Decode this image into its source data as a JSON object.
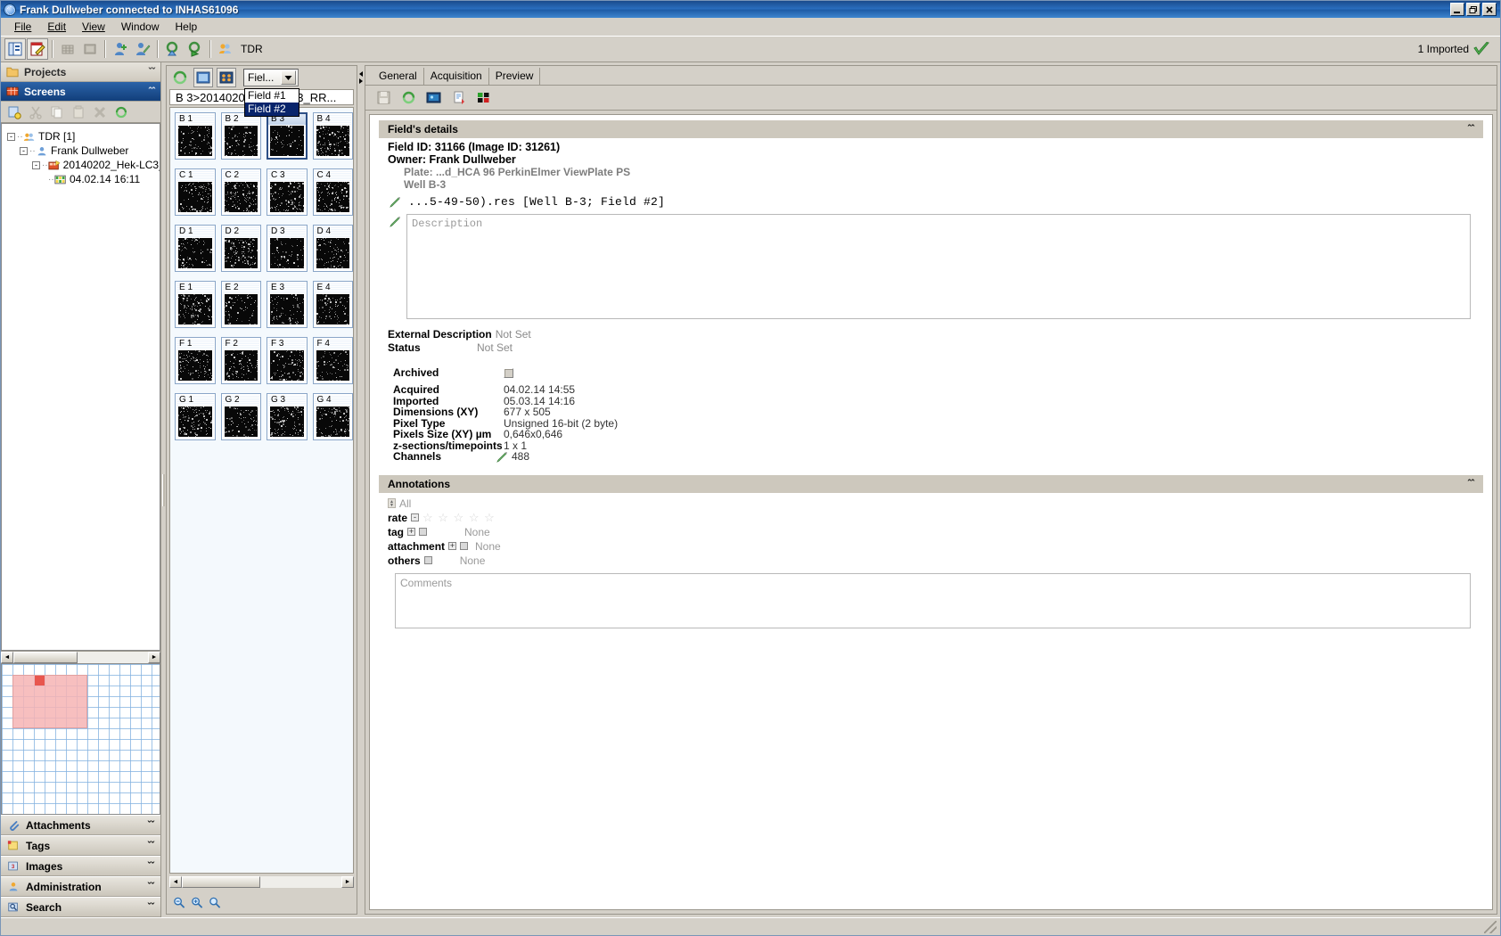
{
  "window": {
    "title": "Frank Dullweber connected to INHAS61096",
    "icon": "app-icon",
    "buttons": {
      "minimize": "_",
      "restore": "❐",
      "close": "✕"
    }
  },
  "menu": {
    "items": [
      "File",
      "Edit",
      "View",
      "Window",
      "Help"
    ]
  },
  "toolbar": {
    "tdr_label": "TDR",
    "status_text": "1 Imported",
    "buttons": [
      "panel-toggle-icon",
      "edit-document-icon",
      "grid-view-icon",
      "image-view-icon",
      "user-add-icon",
      "user-edit-icon",
      "import-icon",
      "export-run-icon",
      "users-group-icon"
    ]
  },
  "sidebar": {
    "groups": [
      {
        "label": "Projects",
        "icon": "folder-icon",
        "state": "collapsed",
        "chevron": "ˇˇ"
      },
      {
        "label": "Screens",
        "icon": "screens-icon",
        "state": "expanded",
        "chevron": "ˆˆ"
      }
    ],
    "tree_toolbar": [
      "new-icon",
      "cut-icon",
      "copy-icon",
      "paste-icon",
      "delete-icon",
      "refresh-icon"
    ],
    "tree": [
      {
        "label": "TDR [1]",
        "icon": "users-group-icon",
        "indent": 0,
        "expander": "-"
      },
      {
        "label": "Frank Dullweber",
        "icon": "user-icon",
        "indent": 1,
        "expander": "-"
      },
      {
        "label": "20140202_Hek-LC3_",
        "icon": "screen-icon",
        "indent": 2,
        "expander": "-"
      },
      {
        "label": "04.02.14 16:11",
        "icon": "plate-icon",
        "indent": 3,
        "expander": ""
      }
    ],
    "bottom_sections": [
      {
        "label": "Attachments",
        "icon": "paperclip-icon",
        "chevron": "ˇˇ"
      },
      {
        "label": "Tags",
        "icon": "tag-note-icon",
        "chevron": "ˇˇ"
      },
      {
        "label": "Images",
        "icon": "images-icon",
        "chevron": "ˇˇ"
      },
      {
        "label": "Administration",
        "icon": "admin-user-icon",
        "chevron": "ˇˇ"
      },
      {
        "label": "Search",
        "icon": "search-icon",
        "chevron": "ˇˇ"
      }
    ]
  },
  "thumbnails": {
    "toolbar": [
      "refresh-icon",
      "single-view-icon",
      "multi-view-icon"
    ],
    "field_selector": {
      "value": "Fiel...",
      "arrow": "▼",
      "open": true,
      "options": [
        "Field #1",
        "Field #2"
      ],
      "selected": "Field #2"
    },
    "title": "B 3>20140202_Hek-LC3_RR...",
    "selected_well": "B 3",
    "rows": [
      {
        "row": "B",
        "wells": [
          "B 1",
          "B 2",
          "B 3",
          "B 4"
        ]
      },
      {
        "row": "C",
        "wells": [
          "C 1",
          "C 2",
          "C 3",
          "C 4"
        ]
      },
      {
        "row": "D",
        "wells": [
          "D 1",
          "D 2",
          "D 3",
          "D 4"
        ]
      },
      {
        "row": "E",
        "wells": [
          "E 1",
          "E 2",
          "E 3",
          "E 4"
        ]
      },
      {
        "row": "F",
        "wells": [
          "F 1",
          "F 2",
          "F 3",
          "F 4"
        ]
      },
      {
        "row": "G",
        "wells": [
          "G 1",
          "G 2",
          "G 3",
          "G 4"
        ]
      }
    ],
    "footer_buttons": [
      "zoom-out-icon",
      "zoom-in-icon",
      "zoom-reset-icon"
    ]
  },
  "main": {
    "tabs": [
      {
        "label": "General",
        "active": true
      },
      {
        "label": "Acquisition",
        "active": false
      },
      {
        "label": "Preview",
        "active": false
      }
    ],
    "toolbar": [
      "save-icon",
      "refresh-icon",
      "show-image-icon",
      "export-report-icon",
      "channels-icon"
    ],
    "fields_details": {
      "header": "Field's details",
      "chevron": "ˆˆ",
      "field_id_line": "Field ID: 31166 (Image ID: 31261)",
      "owner_line": "Owner: Frank Dullweber",
      "plate_line": "Plate: ...d_HCA 96 PerkinElmer ViewPlate PS",
      "well_line": "Well B-3",
      "filename": "...5-49-50).res [Well B-3; Field #2]",
      "description_placeholder": "Description",
      "external_description": {
        "key": "External Description",
        "value": "Not Set"
      },
      "status": {
        "key": "Status",
        "value": "Not Set"
      },
      "metadata": [
        {
          "key": "Archived",
          "value": "",
          "type": "checkbox"
        },
        {
          "key": "Acquired",
          "value": "04.02.14 14:55",
          "type": "text"
        },
        {
          "key": "Imported",
          "value": "05.03.14 14:16",
          "type": "text"
        },
        {
          "key": "Dimensions (XY)",
          "value": "677 x 505",
          "type": "text"
        },
        {
          "key": "Pixel Type",
          "value": "Unsigned 16-bit (2 byte)",
          "type": "text"
        },
        {
          "key": "Pixels Size (XY) µm",
          "value": "0,646x0,646",
          "type": "text"
        },
        {
          "key": "z-sections/timepoints",
          "value": "1 x 1",
          "type": "text"
        },
        {
          "key": "Channels",
          "value": "488",
          "type": "editable"
        }
      ]
    },
    "annotations": {
      "header": "Annotations",
      "chevron": "ˆˆ",
      "all_label": "All",
      "rows": [
        {
          "label": "rate",
          "toggle": "-",
          "type": "stars",
          "stars": 5,
          "value": ""
        },
        {
          "label": "tag",
          "toggle": "+",
          "toggle2": "-",
          "type": "value",
          "value": "None"
        },
        {
          "label": "attachment",
          "toggle": "+",
          "toggle2": "-",
          "type": "value",
          "value": "None"
        },
        {
          "label": "others",
          "toggle": "-",
          "type": "value",
          "value": "None"
        }
      ],
      "comments_placeholder": "Comments"
    }
  },
  "colors": {
    "title_blue": "#1a4b8c",
    "accent_blue": "#2b63a8",
    "chrome_gray": "#d4d0c8",
    "group_header": "#cdc8bd",
    "selection": "#08246b",
    "green_check": "#3f9e3f"
  }
}
